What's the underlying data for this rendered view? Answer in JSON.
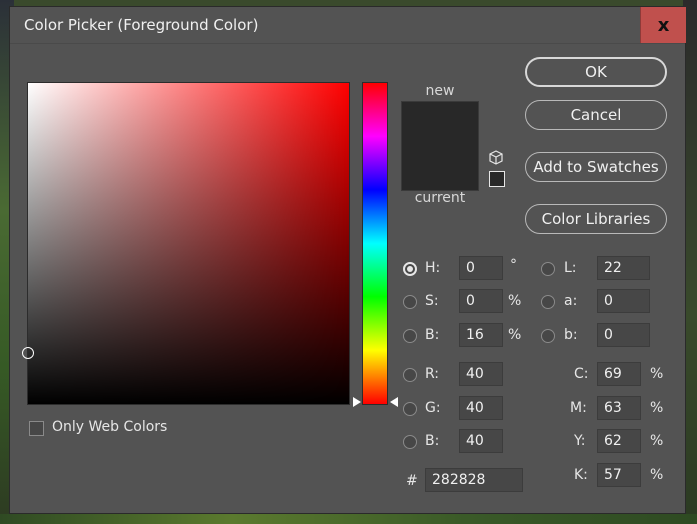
{
  "window": {
    "title": "Color Picker (Foreground Color)",
    "close_glyph": "x"
  },
  "preview": {
    "new_label": "new",
    "current_label": "current",
    "new_color": "#282828",
    "current_color": "#282828"
  },
  "buttons": {
    "ok": "OK",
    "cancel": "Cancel",
    "add_to_swatches": "Add to Swatches",
    "color_libraries": "Color Libraries"
  },
  "fields": {
    "H": {
      "label": "H:",
      "value": "0",
      "unit": "°",
      "selected": true
    },
    "S": {
      "label": "S:",
      "value": "0",
      "unit": "%"
    },
    "B_hsb": {
      "label": "B:",
      "value": "16",
      "unit": "%"
    },
    "R": {
      "label": "R:",
      "value": "40"
    },
    "G": {
      "label": "G:",
      "value": "40"
    },
    "B_rgb": {
      "label": "B:",
      "value": "40"
    },
    "L": {
      "label": "L:",
      "value": "22"
    },
    "a": {
      "label": "a:",
      "value": "0"
    },
    "b_lab": {
      "label": "b:",
      "value": "0"
    },
    "C": {
      "label": "C:",
      "value": "69",
      "unit": "%"
    },
    "M": {
      "label": "M:",
      "value": "63",
      "unit": "%"
    },
    "Y": {
      "label": "Y:",
      "value": "62",
      "unit": "%"
    },
    "K": {
      "label": "K:",
      "value": "57",
      "unit": "%"
    }
  },
  "hex": {
    "label": "#",
    "value": "282828"
  },
  "only_web_colors": {
    "label": "Only Web Colors",
    "checked": false
  },
  "colors": {
    "dialog_bg": "#535353",
    "close_bg": "#c0504d",
    "field_hue": "#ff0000"
  }
}
